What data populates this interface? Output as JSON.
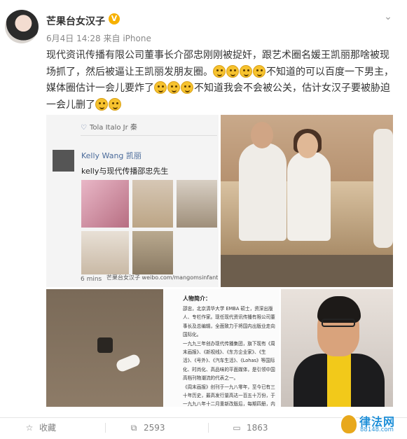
{
  "post": {
    "username": "芒果台女汉子",
    "verified_badge": "V",
    "date": "6月4日 14:28",
    "source_prefix": "来自",
    "source": "iPhone",
    "text_1": "现代资讯传播有限公司董事长介邵忠刚刚被捉奸，跟艺术圈名媛王凯丽那啥被现场抓了，然后被逼让王凯丽发朋友圈。",
    "text_2": "不知道的可以百度一下男主，媒体圈估计一会儿要炸了",
    "text_3": "不知道我会不会被公关，估计女汉子要被胁迫一会儿删了",
    "emoji_name": "doge-emoji",
    "emoji_groups": [
      4,
      3,
      2
    ]
  },
  "image1": {
    "wechat_bar": "Tola Italo Jr 秦",
    "kelly_name": "Kelly Wang 凯丽",
    "kelly_text": "kelly与现代传播邵忠先生",
    "time": "6 mins",
    "watermark": "芒果台女汉子 weibo.com/mangomsinfant"
  },
  "image4": {
    "title": "人物简介：",
    "body": "邵忠，北京清华大学 EMBA 硕士，资深出版人、专栏作家。现任现代资讯传播有限公司董事长及总编辑，全面致力于将国内出版业走向国际化。\n一九九三年创办现代传播集团，旗下现有《周末画报》、《新视线》、《东方企业家》、《生活》、《号外》、《汽车生活》、《Lohas》等国际化、时尚化、高品味的平面媒体，是引领中国高档刊物潮流的代表之一。\n《周末画报》创刊于一九八零年，至今已有三十年历史，最高发行量高达一百五十万份，于一九九八年十二月重新改版后，每期四册，内容涵盖新世纪中国精英所关心的新闻、财富、生活、城市等"
  },
  "actions": {
    "favorite_label": "收藏",
    "repost_count": "2593",
    "comment_count": "1863"
  },
  "site_logo": {
    "text": "律法网",
    "url": "88148.com"
  },
  "colors": {
    "username": "#333333",
    "meta": "#888888",
    "badge": "#f7b100",
    "logo_blue": "#1e8fd8"
  }
}
